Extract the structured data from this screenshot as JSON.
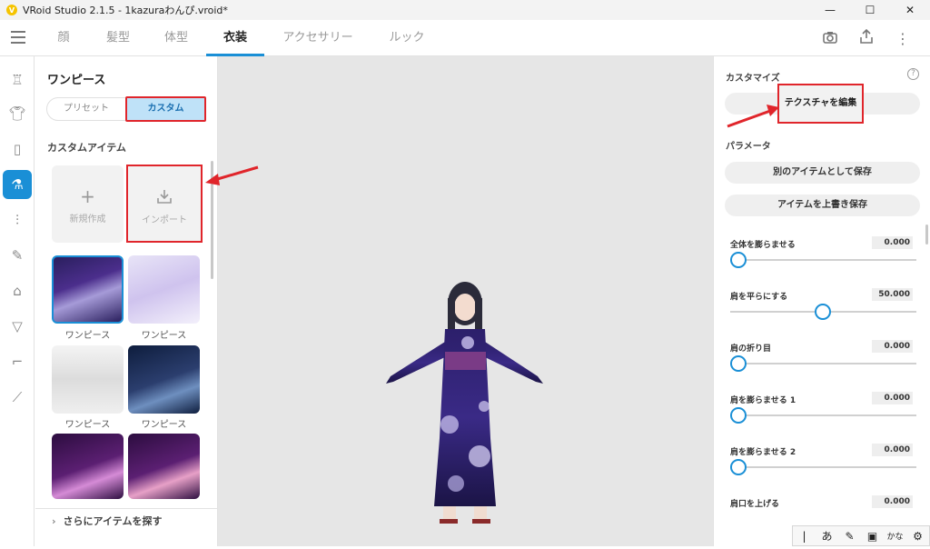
{
  "window": {
    "title": "VRoid Studio 2.1.5 - 1kazuraわんぴ.vroid*",
    "minimize": "—",
    "maximize": "☐",
    "close": "✕"
  },
  "nav": {
    "tabs": [
      {
        "label": "顔",
        "active": false
      },
      {
        "label": "髪型",
        "active": false
      },
      {
        "label": "体型",
        "active": false
      },
      {
        "label": "衣装",
        "active": true
      },
      {
        "label": "アクセサリー",
        "active": false
      },
      {
        "label": "ルック",
        "active": false
      }
    ],
    "icons": [
      "camera-icon",
      "export-icon",
      "more-vertical-icon"
    ]
  },
  "categories": [
    "outer-icon",
    "shirt-icon",
    "pants-icon",
    "onepiece-icon",
    "tie-icon",
    "brush-icon",
    "tank-icon",
    "underwear-icon",
    "sock-icon",
    "shoe-icon"
  ],
  "left": {
    "title": "ワンピース",
    "segment": {
      "preset": "プリセット",
      "custom": "カスタム"
    },
    "section": "カスタムアイテム",
    "new_label": "新規作成",
    "import_label": "インポート",
    "items": [
      "ワンピース",
      "ワンピース",
      "ワンピース",
      "ワンピース",
      "",
      ""
    ],
    "more": "さらにアイテムを探す"
  },
  "right": {
    "customize": "カスタマイズ",
    "help": "?",
    "edit_texture": "テクスチャを編集",
    "parameters": "パラメータ",
    "save_as": "別のアイテムとして保存",
    "overwrite": "アイテムを上書き保存",
    "sliders": [
      {
        "name": "全体を膨らませる",
        "value": "0.000",
        "level": 0.0
      },
      {
        "name": "肩を平らにする",
        "value": "50.000",
        "level": 0.5
      },
      {
        "name": "肩の折り目",
        "value": "0.000",
        "level": 0.0
      },
      {
        "name": "肩を膨らませる 1",
        "value": "0.000",
        "level": 0.0
      },
      {
        "name": "肩を膨らませる 2",
        "value": "0.000",
        "level": 0.0
      },
      {
        "name": "肩口を上げる",
        "value": "0.000",
        "level": 0.0
      }
    ]
  },
  "ime": [
    "|",
    "あ",
    "✎",
    "▣",
    "かな",
    "⚙"
  ],
  "colors": {
    "accent": "#1a8fd6",
    "highlight": "#e0252b"
  }
}
